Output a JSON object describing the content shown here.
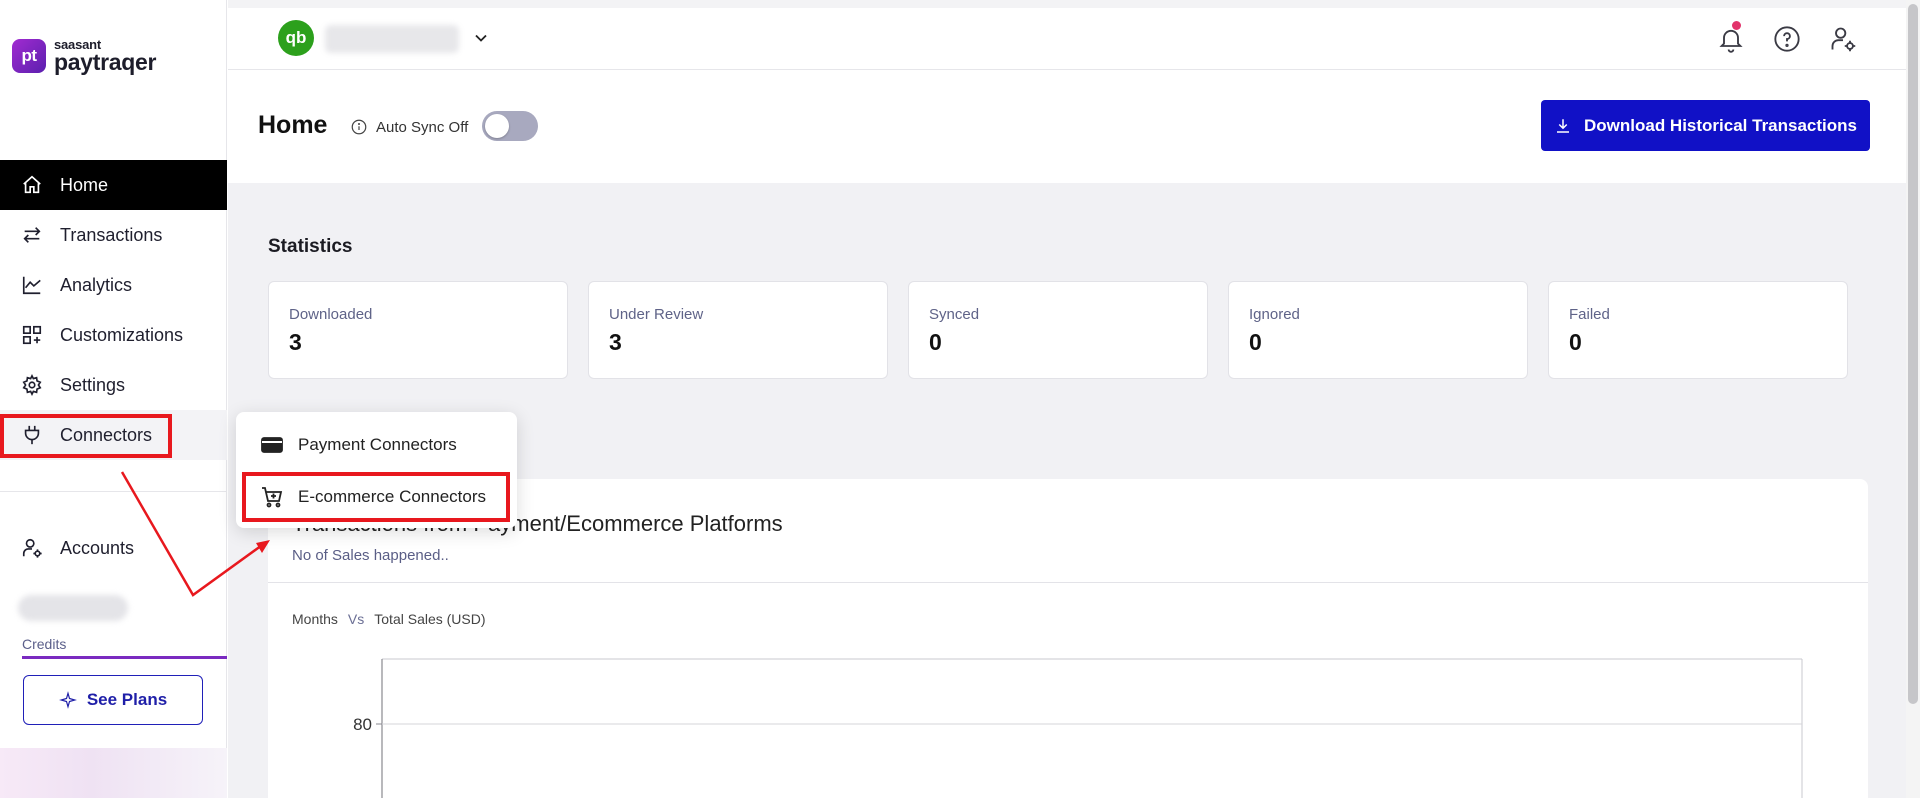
{
  "brand": {
    "logo_text": "pt",
    "small": "saasant",
    "name": "paytraqer"
  },
  "sidebar": {
    "items": [
      {
        "label": "Home",
        "icon": "home-icon"
      },
      {
        "label": "Transactions",
        "icon": "transfer-arrows-icon"
      },
      {
        "label": "Analytics",
        "icon": "line-chart-icon"
      },
      {
        "label": "Customizations",
        "icon": "grid-plus-icon"
      },
      {
        "label": "Settings",
        "icon": "gear-icon"
      },
      {
        "label": "Connectors",
        "icon": "plug-icon"
      }
    ],
    "accounts_label": "Accounts",
    "credits_label": "Credits",
    "see_plans_label": "See Plans"
  },
  "header": {
    "qb_logo_text": "qb"
  },
  "page": {
    "title": "Home",
    "auto_sync_label": "Auto Sync Off",
    "download_button": "Download Historical Transactions"
  },
  "statistics": {
    "title": "Statistics",
    "cards": [
      {
        "label": "Downloaded",
        "value": "3"
      },
      {
        "label": "Under Review",
        "value": "3"
      },
      {
        "label": "Synced",
        "value": "0"
      },
      {
        "label": "Ignored",
        "value": "0"
      },
      {
        "label": "Failed",
        "value": "0"
      }
    ]
  },
  "chart_panel": {
    "title": "Transactions from Payment/Ecommerce Platforms",
    "subtitle": "No of Sales happened..",
    "x_caption": "Months",
    "vs_label": "Vs",
    "y_caption": "Total Sales (USD)"
  },
  "chart_data": {
    "type": "bar",
    "xlabel": "Months",
    "ylabel": "Total Sales (USD)",
    "y_ticks": [
      80
    ],
    "grid": true
  },
  "connectors_menu": {
    "items": [
      {
        "label": "Payment Connectors",
        "icon": "credit-card-icon"
      },
      {
        "label": "E-commerce Connectors",
        "icon": "cart-plus-icon"
      }
    ]
  },
  "colors": {
    "primary": "#1111c6",
    "annotation": "#e8181e",
    "active_nav": "#000000",
    "credits_bar": "#7a2ac0"
  }
}
